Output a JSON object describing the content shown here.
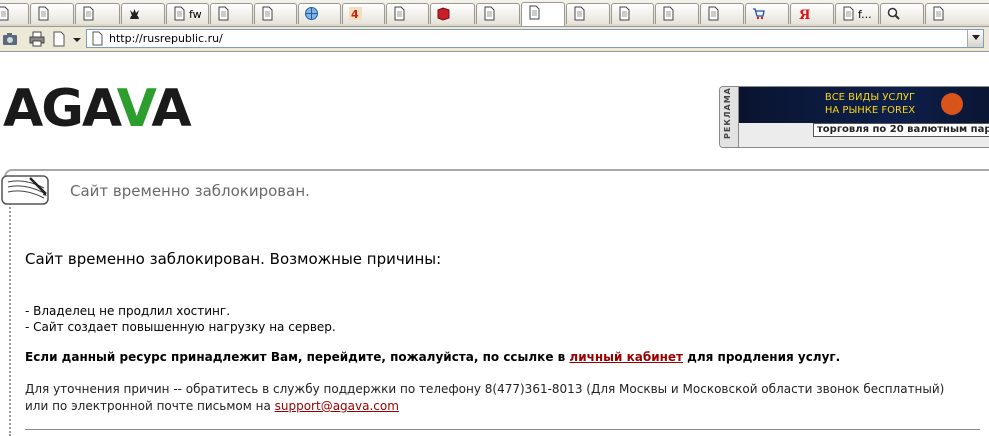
{
  "browser": {
    "tabs": [
      {
        "label": "",
        "icon": "page-icon"
      },
      {
        "label": "",
        "icon": "page-icon"
      },
      {
        "label": "",
        "icon": "page-icon"
      },
      {
        "label": "",
        "icon": "chess-queen-icon"
      },
      {
        "label": "fw",
        "icon": "page-icon"
      },
      {
        "label": "",
        "icon": "page-icon"
      },
      {
        "label": "",
        "icon": "page-icon"
      },
      {
        "label": "",
        "icon": "globe-icon"
      },
      {
        "label": "",
        "icon": "red-4-icon"
      },
      {
        "label": "",
        "icon": "page-icon"
      },
      {
        "label": "",
        "icon": "book-icon"
      },
      {
        "label": "",
        "icon": "page-icon"
      },
      {
        "label": "",
        "icon": "page-icon"
      },
      {
        "label": "",
        "icon": "page-icon"
      },
      {
        "label": "",
        "icon": "page-icon"
      },
      {
        "label": "",
        "icon": "page-icon"
      },
      {
        "label": "",
        "icon": "page-icon"
      },
      {
        "label": "",
        "icon": "cart-icon"
      },
      {
        "label": "",
        "icon": "yandex-icon"
      },
      {
        "label": "f...",
        "icon": "page-icon"
      },
      {
        "label": "",
        "icon": "magnifier-icon"
      },
      {
        "label": "",
        "icon": "page-icon"
      }
    ],
    "active_tab_index": 12,
    "address_url": "http://rusrepublic.ru/"
  },
  "page": {
    "logo": {
      "before": "AGA",
      "accent": "V",
      "after": "A",
      "accent_color": "#2d9e2d"
    },
    "banner": {
      "side_label": "РЕКЛАМА",
      "headline_line1": "ВСЕ ВИДЫ УСЛУГ",
      "headline_line2": "НА РЫНКЕ FOREX",
      "sub_text": "торговля по 20 валютным пар"
    },
    "notice_title": "Сайт временно заблокирован.",
    "reasons_heading": "Сайт временно заблокирован. Возможные причины:",
    "reasons": [
      "- Владелец не продлил хостинг.",
      "- Сайт создает повышенную нагрузку на сервер."
    ],
    "owner_prefix": "Если данный ресурс принадлежит Вам, перейдите, пожалуйста, по ссылке в ",
    "owner_link": "личный кабинет",
    "owner_suffix": " для продления услуг.",
    "contact_line1": "Для уточнения причин -- обратитесь в службу поддержки по телефону 8(477)361-8013 (Для Москвы и Московской области звонок бесплатный)",
    "contact_prefix": "или по электронной почте письмом на ",
    "contact_email": "support@agava.com"
  }
}
